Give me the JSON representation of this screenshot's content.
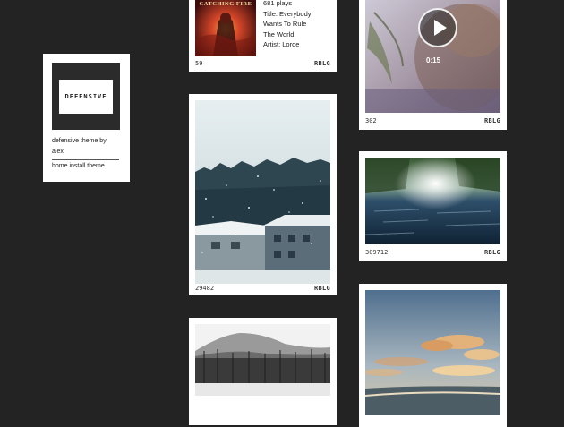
{
  "sidebar": {
    "logo_text": "DEFENSIVE",
    "description_line1": "defensive theme by",
    "description_line2": "alex",
    "links": [
      "home",
      "install theme"
    ]
  },
  "posts": {
    "audio": {
      "plays": "681 plays",
      "title": "Title: Everybody",
      "title_cont1": "Wants To Rule",
      "title_cont2": "The World",
      "artist": "Artist: Lorde",
      "album_art_caption": "CATCHING FIRE",
      "notes": "59",
      "reblog": "RBLG"
    },
    "video": {
      "duration": "0:15",
      "notes": "302",
      "reblog": "RBLG"
    },
    "winter_photo": {
      "notes": "29482",
      "reblog": "RBLG"
    },
    "water_photo": {
      "notes": "309712",
      "reblog": "RBLG"
    },
    "hills_photo": {},
    "sky_photo": {}
  },
  "colors": {
    "background": "#232323",
    "card": "#ffffff",
    "text": "#222222"
  }
}
